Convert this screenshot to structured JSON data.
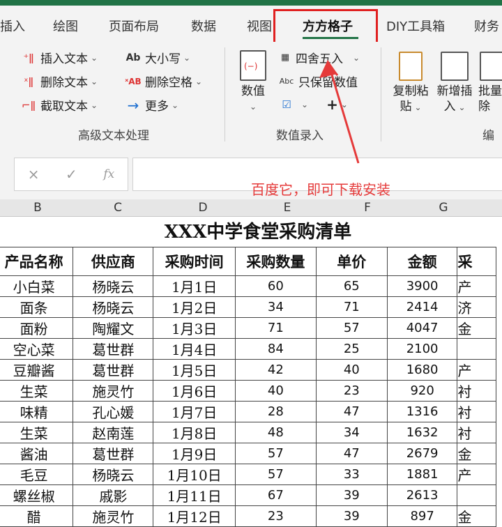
{
  "tabs": [
    "插入",
    "绘图",
    "页面布局",
    "数据",
    "视图",
    "方方格子",
    "DIY工具箱",
    "财务"
  ],
  "active_tab": "方方格子",
  "ribbon": {
    "text_group": {
      "items": [
        "插入文本",
        "删除文本",
        "截取文本"
      ],
      "items2": [
        "大小写",
        "删除空格",
        "更多"
      ],
      "label": "高级文本处理"
    },
    "number_group": {
      "big_label": "数值",
      "round": "四舍五入",
      "keep_number": "只保留数值",
      "label": "数值录入"
    },
    "edit_group": {
      "copy_paste": [
        "复制粘",
        "贴"
      ],
      "add_insert": [
        "新增插",
        "入"
      ],
      "batch": [
        "批量",
        "除"
      ],
      "label": "编辑"
    }
  },
  "formula_bar": {
    "cancel": "×",
    "confirm": "✓",
    "fx": "fx",
    "value": ""
  },
  "annotation": "百度它，即可下载安装",
  "accent_color": "#217346",
  "highlight_color": "#e02020",
  "columns": [
    "B",
    "C",
    "D",
    "E",
    "F",
    "G"
  ],
  "sheet_title": "XXX中学食堂采购清单",
  "table": {
    "headers": [
      "产品名称",
      "供应商",
      "采购时间",
      "采购数量",
      "单价",
      "金额",
      "采"
    ],
    "rows": [
      [
        "小白菜",
        "杨晓云",
        "1月1日",
        "60",
        "65",
        "3900",
        "产"
      ],
      [
        "面条",
        "杨晓云",
        "1月2日",
        "34",
        "71",
        "2414",
        "济"
      ],
      [
        "面粉",
        "陶耀文",
        "1月3日",
        "71",
        "57",
        "4047",
        "金"
      ],
      [
        "空心菜",
        "葛世群",
        "1月4日",
        "84",
        "25",
        "2100",
        ""
      ],
      [
        "豆瓣酱",
        "葛世群",
        "1月5日",
        "42",
        "40",
        "1680",
        "产"
      ],
      [
        "生菜",
        "施灵竹",
        "1月6日",
        "40",
        "23",
        "920",
        "衬"
      ],
      [
        "味精",
        "孔心媛",
        "1月7日",
        "28",
        "47",
        "1316",
        "衬"
      ],
      [
        "生菜",
        "赵南莲",
        "1月8日",
        "48",
        "34",
        "1632",
        "衬"
      ],
      [
        "酱油",
        "葛世群",
        "1月9日",
        "57",
        "47",
        "2679",
        "金"
      ],
      [
        "毛豆",
        "杨晓云",
        "1月10日",
        "57",
        "33",
        "1881",
        "产"
      ],
      [
        "螺丝椒",
        "戚影",
        "1月11日",
        "67",
        "39",
        "2613",
        ""
      ],
      [
        "醋",
        "施灵竹",
        "1月12日",
        "23",
        "39",
        "897",
        "金"
      ]
    ]
  }
}
